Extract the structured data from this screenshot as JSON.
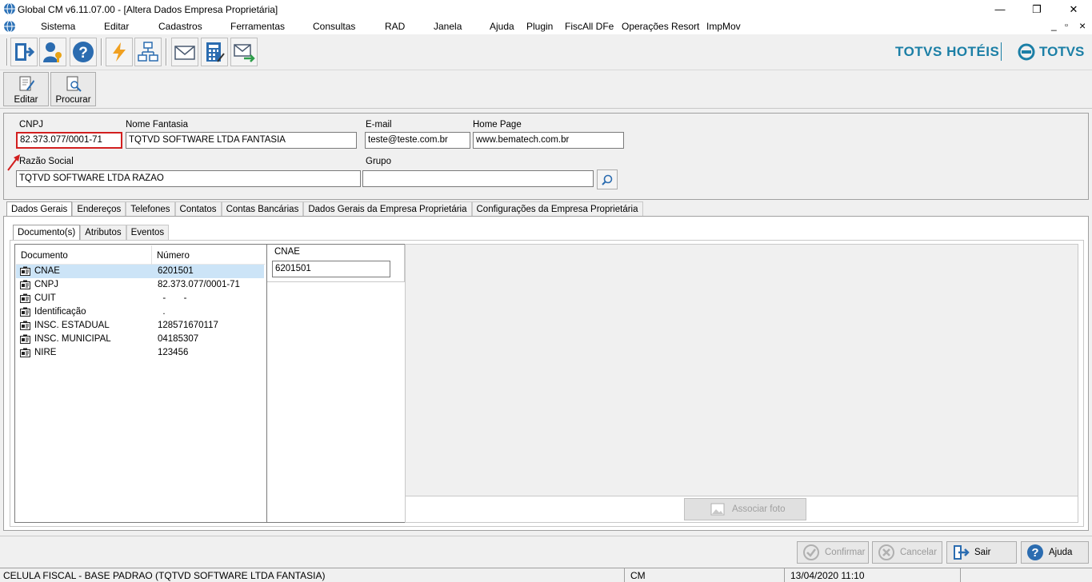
{
  "window": {
    "title": "Global CM v6.11.07.00 - [Altera Dados Empresa Proprietária]",
    "minimize": "—",
    "restore": "❐",
    "close": "✕"
  },
  "menu": {
    "items": [
      "Sistema",
      "Editar",
      "Cadastros",
      "Ferramentas",
      "Consultas",
      "RAD",
      "Janela",
      "Ajuda",
      "Plugin",
      "FiscAll DFe",
      "Operações Resort",
      "ImpMov"
    ],
    "mdi_min": "_",
    "mdi_restore": "▫",
    "mdi_close": "×"
  },
  "brand": {
    "left": "TOTVS HOTÉIS",
    "right": "TOTVS",
    "color": "#1b7fa6"
  },
  "actions": {
    "edit": "Editar",
    "search": "Procurar"
  },
  "form": {
    "cnpj_label": "CNPJ",
    "cnpj_value": "82.373.077/0001-71",
    "nome_fantasia_label": "Nome Fantasia",
    "nome_fantasia_value": "TQTVD SOFTWARE LTDA FANTASIA",
    "email_label": "E-mail",
    "email_value": "teste@teste.com.br",
    "homepage_label": "Home Page",
    "homepage_value": "www.bematech.com.br",
    "razao_label": "Razão Social",
    "razao_value": "TQTVD SOFTWARE LTDA RAZAO",
    "grupo_label": "Grupo",
    "grupo_value": ""
  },
  "tabs": [
    "Dados Gerais",
    "Endereços",
    "Telefones",
    "Contatos",
    "Contas Bancárias",
    "Dados Gerais da Empresa Proprietária",
    "Configurações da Empresa Proprietária"
  ],
  "subtabs": [
    "Documento(s)",
    "Atributos",
    "Eventos"
  ],
  "documents": {
    "col_doc": "Documento",
    "col_num": "Número",
    "rows": [
      {
        "doc": "CNAE",
        "num": "6201501"
      },
      {
        "doc": "CNPJ",
        "num": "82.373.077/0001-71"
      },
      {
        "doc": "CUIT",
        "num": "  -       -"
      },
      {
        "doc": "Identificação",
        "num": "  ."
      },
      {
        "doc": "INSC. ESTADUAL",
        "num": "128571670117"
      },
      {
        "doc": "INSC. MUNICIPAL",
        "num": "04185307"
      },
      {
        "doc": "NIRE",
        "num": "123456"
      }
    ]
  },
  "detail": {
    "label": "CNAE",
    "value": "6201501"
  },
  "photo": {
    "button": "Associar foto"
  },
  "bottom": {
    "confirm": "Confirmar",
    "cancel": "Cancelar",
    "exit": "Sair",
    "help": "Ajuda"
  },
  "status": {
    "company": "CELULA FISCAL - BASE PADRAO (TQTVD SOFTWARE LTDA FANTASIA)",
    "module": "CM",
    "datetime": "13/04/2020 11:10"
  }
}
